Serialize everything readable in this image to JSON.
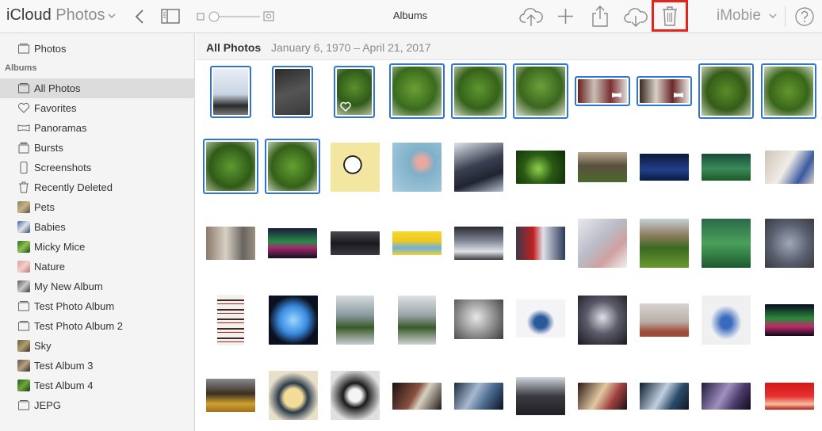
{
  "app": {
    "brand_primary": "iCloud",
    "brand_secondary": "Photos",
    "view_title": "Albums",
    "account_name": "iMobie"
  },
  "toolbar": {
    "icons": [
      "back-icon",
      "sidebar-toggle-icon",
      "zoom-slider",
      "upload-icon",
      "add-icon",
      "share-icon",
      "download-icon",
      "trash-icon",
      "help-icon"
    ],
    "highlight_color": "#e3261b"
  },
  "sidebar": {
    "top_item": {
      "label": "Photos",
      "icon": "photos-icon"
    },
    "section_label": "Albums",
    "items": [
      {
        "label": "All Photos",
        "icon": "all-photos-icon",
        "active": true
      },
      {
        "label": "Favorites",
        "icon": "heart-icon"
      },
      {
        "label": "Panoramas",
        "icon": "panorama-icon"
      },
      {
        "label": "Bursts",
        "icon": "bursts-icon"
      },
      {
        "label": "Screenshots",
        "icon": "screenshot-icon"
      },
      {
        "label": "Recently Deleted",
        "icon": "trash-icon"
      },
      {
        "label": "Pets",
        "icon": "album-thumb"
      },
      {
        "label": "Babies",
        "icon": "album-thumb"
      },
      {
        "label": "Micky Mice",
        "icon": "album-thumb"
      },
      {
        "label": "Nature",
        "icon": "album-thumb"
      },
      {
        "label": "My New Album",
        "icon": "album-thumb"
      },
      {
        "label": "Test Photo Album",
        "icon": "album-icon"
      },
      {
        "label": "Test Photo Album 2",
        "icon": "album-icon"
      },
      {
        "label": "Sky",
        "icon": "album-thumb"
      },
      {
        "label": "Test Album 3",
        "icon": "album-thumb"
      },
      {
        "label": "Test Album 4",
        "icon": "album-thumb"
      },
      {
        "label": "JEPG",
        "icon": "album-icon"
      }
    ]
  },
  "main": {
    "title": "All Photos",
    "date_range": "January 6, 1970 – April 21, 2017",
    "selection_color": "#2f75d6"
  }
}
